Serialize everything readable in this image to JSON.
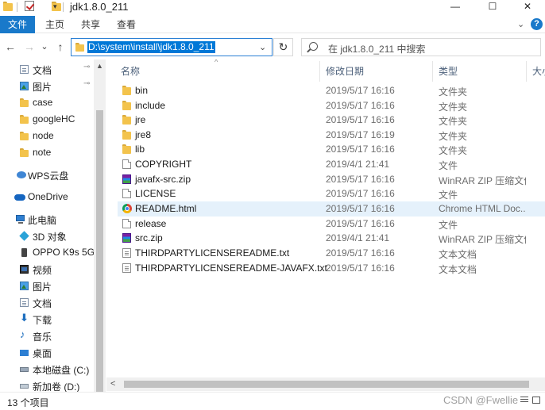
{
  "window": {
    "title": "jdk1.8.0_211",
    "minimize_label": "—",
    "maximize_label": "☐",
    "close_label": "✕"
  },
  "ribbon": {
    "tabs": [
      "文件",
      "主页",
      "共享",
      "查看"
    ],
    "expand_icon": "chevron-down-icon",
    "help_label": "?",
    "accent_color": "#1979ca"
  },
  "navigation": {
    "back_label": "←",
    "forward_label": "→",
    "recent_label": "⌄",
    "up_label": "↑",
    "address": "D:\\system\\install\\jdk1.8.0_211",
    "address_dropdown_label": "⌄",
    "refresh_label": "↻",
    "search_placeholder": "在 jdk1.8.0_211 中搜索"
  },
  "sidebar": {
    "items": [
      {
        "label": "文档",
        "icon": "document-icon",
        "pinned": true
      },
      {
        "label": "图片",
        "icon": "picture-icon",
        "pinned": true
      },
      {
        "label": "case",
        "icon": "folder-icon",
        "pinned": false
      },
      {
        "label": "googleHC",
        "icon": "folder-icon",
        "pinned": false
      },
      {
        "label": "node",
        "icon": "folder-icon",
        "pinned": false
      },
      {
        "label": "note",
        "icon": "folder-icon",
        "pinned": false
      },
      {
        "label": "WPS云盘",
        "icon": "wps-cloud-icon",
        "pinned": false
      },
      {
        "label": "OneDrive",
        "icon": "onedrive-icon",
        "pinned": false
      },
      {
        "label": "此电脑",
        "icon": "this-pc-icon",
        "pinned": false
      },
      {
        "label": "3D 对象",
        "icon": "3d-objects-icon",
        "pinned": false
      },
      {
        "label": "OPPO K9s 5G",
        "icon": "phone-icon",
        "pinned": false
      },
      {
        "label": "视频",
        "icon": "video-icon",
        "pinned": false
      },
      {
        "label": "图片",
        "icon": "picture-icon",
        "pinned": false
      },
      {
        "label": "文档",
        "icon": "document-icon",
        "pinned": false
      },
      {
        "label": "下载",
        "icon": "download-icon",
        "pinned": false
      },
      {
        "label": "音乐",
        "icon": "music-icon",
        "pinned": false
      },
      {
        "label": "桌面",
        "icon": "desktop-icon",
        "pinned": false
      },
      {
        "label": "本地磁盘 (C:)",
        "icon": "local-disk-icon",
        "pinned": false
      },
      {
        "label": "新加卷 (D:)",
        "icon": "drive-icon",
        "pinned": false
      }
    ],
    "pin_label": "📌"
  },
  "columns": [
    "名称",
    "修改日期",
    "类型",
    "大小"
  ],
  "files": [
    {
      "name": "bin",
      "date": "2019/5/17 16:16",
      "type": "文件夹",
      "icon": "folder-icon"
    },
    {
      "name": "include",
      "date": "2019/5/17 16:16",
      "type": "文件夹",
      "icon": "folder-icon"
    },
    {
      "name": "jre",
      "date": "2019/5/17 16:16",
      "type": "文件夹",
      "icon": "folder-icon"
    },
    {
      "name": "jre8",
      "date": "2019/5/17 16:19",
      "type": "文件夹",
      "icon": "folder-icon"
    },
    {
      "name": "lib",
      "date": "2019/5/17 16:16",
      "type": "文件夹",
      "icon": "folder-icon"
    },
    {
      "name": "COPYRIGHT",
      "date": "2019/4/1 21:41",
      "type": "文件",
      "icon": "file-icon"
    },
    {
      "name": "javafx-src.zip",
      "date": "2019/5/17 16:16",
      "type": "WinRAR ZIP 压缩文件",
      "icon": "winrar-zip-icon"
    },
    {
      "name": "LICENSE",
      "date": "2019/5/17 16:16",
      "type": "文件",
      "icon": "file-icon"
    },
    {
      "name": "README.html",
      "date": "2019/5/17 16:16",
      "type": "Chrome HTML Doc...",
      "icon": "chrome-html-icon"
    },
    {
      "name": "release",
      "date": "2019/5/17 16:16",
      "type": "文件",
      "icon": "file-icon"
    },
    {
      "name": "src.zip",
      "date": "2019/4/1 21:41",
      "type": "WinRAR ZIP 压缩文件",
      "icon": "winrar-zip-icon"
    },
    {
      "name": "THIRDPARTYLICENSEREADME.txt",
      "date": "2019/5/17 16:16",
      "type": "文本文档",
      "icon": "text-file-icon"
    },
    {
      "name": "THIRDPARTYLICENSEREADME-JAVAFX.txt",
      "date": "2019/5/17 16:16",
      "type": "文本文档",
      "icon": "text-file-icon"
    }
  ],
  "selected_file": "README.html",
  "status": {
    "item_count": "13 个项目",
    "watermark": "CSDN @Fwellie"
  },
  "colors": {
    "selection_highlight": "#e5f1fb",
    "address_selection": "#0078d7",
    "folder": "#f3c34c"
  }
}
